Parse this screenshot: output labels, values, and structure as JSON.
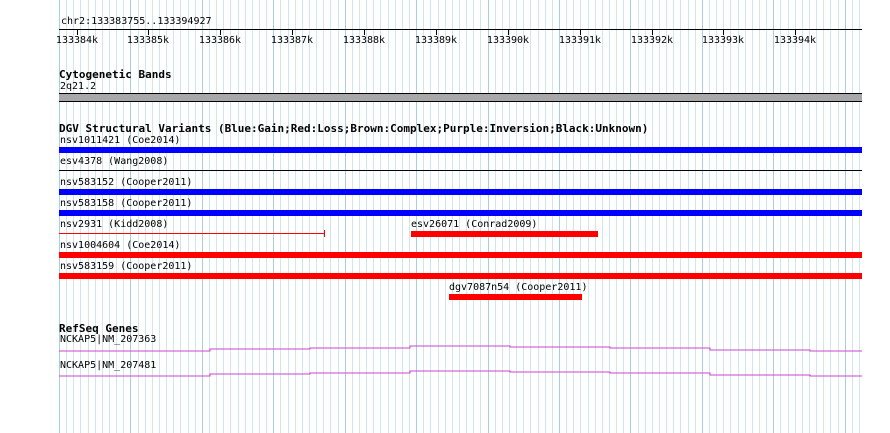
{
  "location": "chr2:133383755..133394927",
  "ruler": {
    "ticks": [
      {
        "label": "133384k",
        "pos": 133384
      },
      {
        "label": "133385k",
        "pos": 133385
      },
      {
        "label": "133386k",
        "pos": 133386
      },
      {
        "label": "133387k",
        "pos": 133387
      },
      {
        "label": "133388k",
        "pos": 133388
      },
      {
        "label": "133389k",
        "pos": 133389
      },
      {
        "label": "133390k",
        "pos": 133390
      },
      {
        "label": "133391k",
        "pos": 133391
      },
      {
        "label": "133392k",
        "pos": 133392
      },
      {
        "label": "133393k",
        "pos": 133393
      },
      {
        "label": "133394k",
        "pos": 133394
      }
    ]
  },
  "tracks": {
    "cytoband": {
      "title": "Cytogenetic Bands",
      "band": "2q21.2"
    },
    "dgv": {
      "title": "DGV Structural Variants (Blue:Gain;Red:Loss;Brown:Complex;Purple:Inversion;Black:Unknown)",
      "features": [
        {
          "name": "nsv1011421 (Coe2014)",
          "color": "#0000ff"
        },
        {
          "name": "esv4378 (Wang2008)",
          "color": "#000000"
        },
        {
          "name": "nsv583152 (Cooper2011)",
          "color": "#0000ff"
        },
        {
          "name": "nsv583158 (Cooper2011)",
          "color": "#0000ff"
        },
        {
          "name": "nsv2931 (Kidd2008)",
          "color": "#ff0000"
        },
        {
          "name": "esv26071 (Conrad2009)",
          "color": "#ff0000"
        },
        {
          "name": "nsv1004604 (Coe2014)",
          "color": "#ff0000"
        },
        {
          "name": "nsv583159 (Cooper2011)",
          "color": "#ff0000"
        },
        {
          "name": "dgv7087n54 (Cooper2011)",
          "color": "#ff0000"
        }
      ]
    },
    "refseq": {
      "title": "RefSeq Genes",
      "genes": [
        {
          "name": "NCKAP5|NM_207363",
          "color": "#cc44cc"
        },
        {
          "name": "NCKAP5|NM_207481",
          "color": "#cc44cc"
        }
      ]
    }
  }
}
